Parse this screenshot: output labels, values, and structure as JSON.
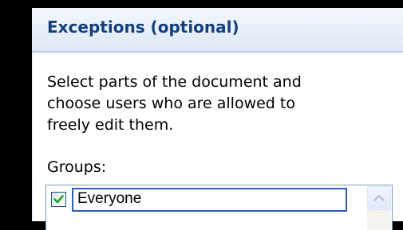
{
  "pane": {
    "header_title": "Exceptions (optional)",
    "description_lines": [
      "Select parts of the document and",
      "choose users who are allowed to",
      "freely edit them."
    ],
    "groups_label": "Groups:"
  },
  "groups": {
    "items": [
      {
        "label": "Everyone",
        "checked": true
      }
    ]
  },
  "colors": {
    "header_text": "#123f7c",
    "checkmark": "#21a121",
    "focus_border": "#2a5fb4"
  },
  "icons": {
    "checkbox": "checkmark-icon",
    "scroll_up": "chevron-up-icon"
  }
}
